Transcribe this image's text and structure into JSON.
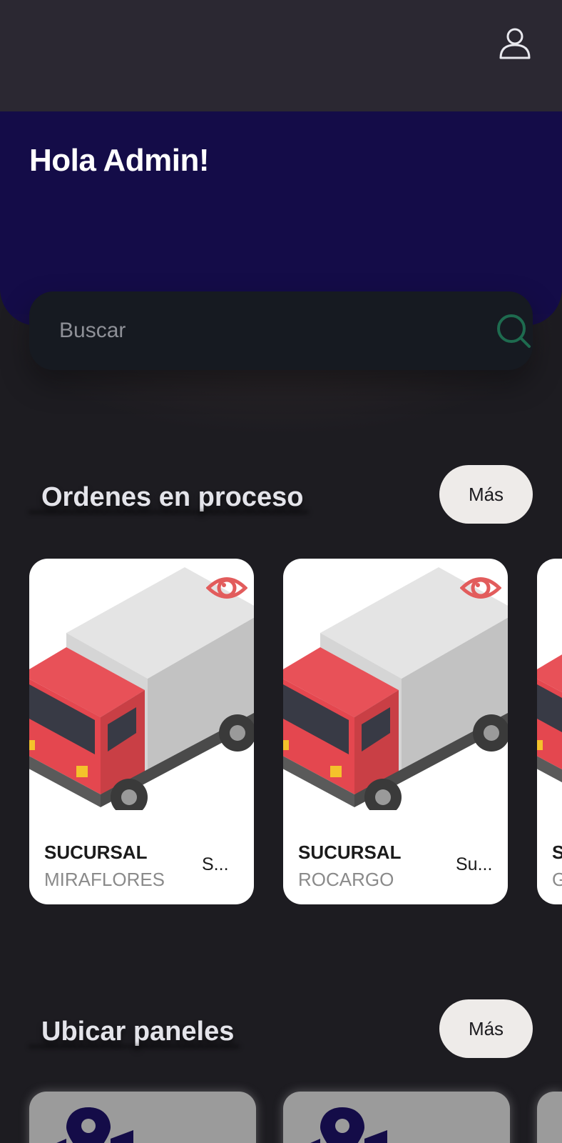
{
  "header": {
    "greeting": "Hola Admin!"
  },
  "search": {
    "placeholder": "Buscar"
  },
  "sections": {
    "orders": {
      "title": "Ordenes en proceso",
      "more_label": "Más"
    },
    "panels": {
      "title": "Ubicar paneles",
      "more_label": "Más"
    }
  },
  "orders": [
    {
      "title": "SUCURSAL",
      "subtitle": "MIRAFLORES",
      "extra": "S..."
    },
    {
      "title": "SUCURSAL",
      "subtitle": "ROCARGO",
      "extra": "Su..."
    },
    {
      "title": "S",
      "subtitle": "G",
      "extra": ""
    }
  ],
  "colors": {
    "topbar": "#2b2832",
    "hero": "#140c48",
    "background": "#1d1c21",
    "search_bg": "#161a21",
    "search_icon": "#1e6b4f",
    "eye_icon": "#e25c5c",
    "truck_cab": "#e8525a",
    "panel_icon": "#140c48"
  },
  "icons": {
    "profile": "person-outline-icon",
    "search": "search-icon",
    "order_view": "eye-icon",
    "order_image": "truck-illustration",
    "panel_image": "map-pin-icon"
  }
}
